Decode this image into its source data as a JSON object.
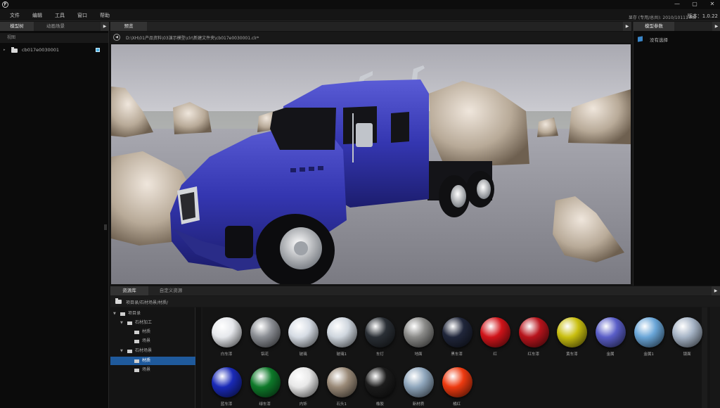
{
  "titlebar": {
    "logo": "F",
    "minimize": "—",
    "restore": "▢",
    "close": "✕"
  },
  "menu": [
    "文件",
    "编辑",
    "工具",
    "窗口",
    "帮助"
  ],
  "status": {
    "memory": "显存 (专用/总共): 2010/10111 MB",
    "version": "版本：1.0.22"
  },
  "left_panel": {
    "tabs": [
      "模型树",
      "动画场景"
    ],
    "sub_header": "视图",
    "tree_item": "cb017e0030001"
  },
  "preview": {
    "tab": "预览",
    "path": "D:\\XH\\01产品资料\\03演示模型\\clr\\新建文件夹\\cb017e0030001.clr*"
  },
  "right_panel": {
    "tab": "模型参数",
    "empty_text": "没有选择"
  },
  "library": {
    "tabs": [
      "资源库",
      "自定义资源"
    ],
    "path": "项目录/石材场景/材质/",
    "tree": [
      {
        "label": "项目录",
        "level": 0
      },
      {
        "label": "石材加工",
        "level": 1
      },
      {
        "label": "材质",
        "level": 2
      },
      {
        "label": "场景",
        "level": 2
      },
      {
        "label": "石材场景",
        "level": 1
      },
      {
        "label": "材质",
        "level": 2,
        "selected": true
      },
      {
        "label": "场景",
        "level": 2
      }
    ],
    "materials": [
      {
        "label": "白车漆",
        "color": "#e6e8ec"
      },
      {
        "label": "铝花",
        "color": "#8b8e94"
      },
      {
        "label": "玻璃",
        "color": "#d6dce4"
      },
      {
        "label": "玻璃1",
        "color": "#cfd6de"
      },
      {
        "label": "车灯",
        "color": "#2a2f35"
      },
      {
        "label": "地面",
        "color": "#8a8a88"
      },
      {
        "label": "黑车漆",
        "color": "#20263a"
      },
      {
        "label": "红",
        "color": "#d0141a"
      },
      {
        "label": "红车漆",
        "color": "#b8141c"
      },
      {
        "label": "黄车漆",
        "color": "#c9bf10"
      },
      {
        "label": "金属",
        "color": "#5a5ec8"
      },
      {
        "label": "金属1",
        "color": "#6aa6d8"
      },
      {
        "label": "镜面",
        "color": "#a6b4c6"
      },
      {
        "label": "蓝车漆",
        "color": "#1a2ab8"
      },
      {
        "label": "绿车漆",
        "color": "#0e7a2a"
      },
      {
        "label": "内饰",
        "color": "#e8e8e8"
      },
      {
        "label": "石头1",
        "color": "#9a8a78"
      },
      {
        "label": "橡胶",
        "color": "#1c1c1c"
      },
      {
        "label": "新材质",
        "color": "#8fa6bc"
      },
      {
        "label": "橘红",
        "color": "#ee3a10"
      }
    ]
  }
}
